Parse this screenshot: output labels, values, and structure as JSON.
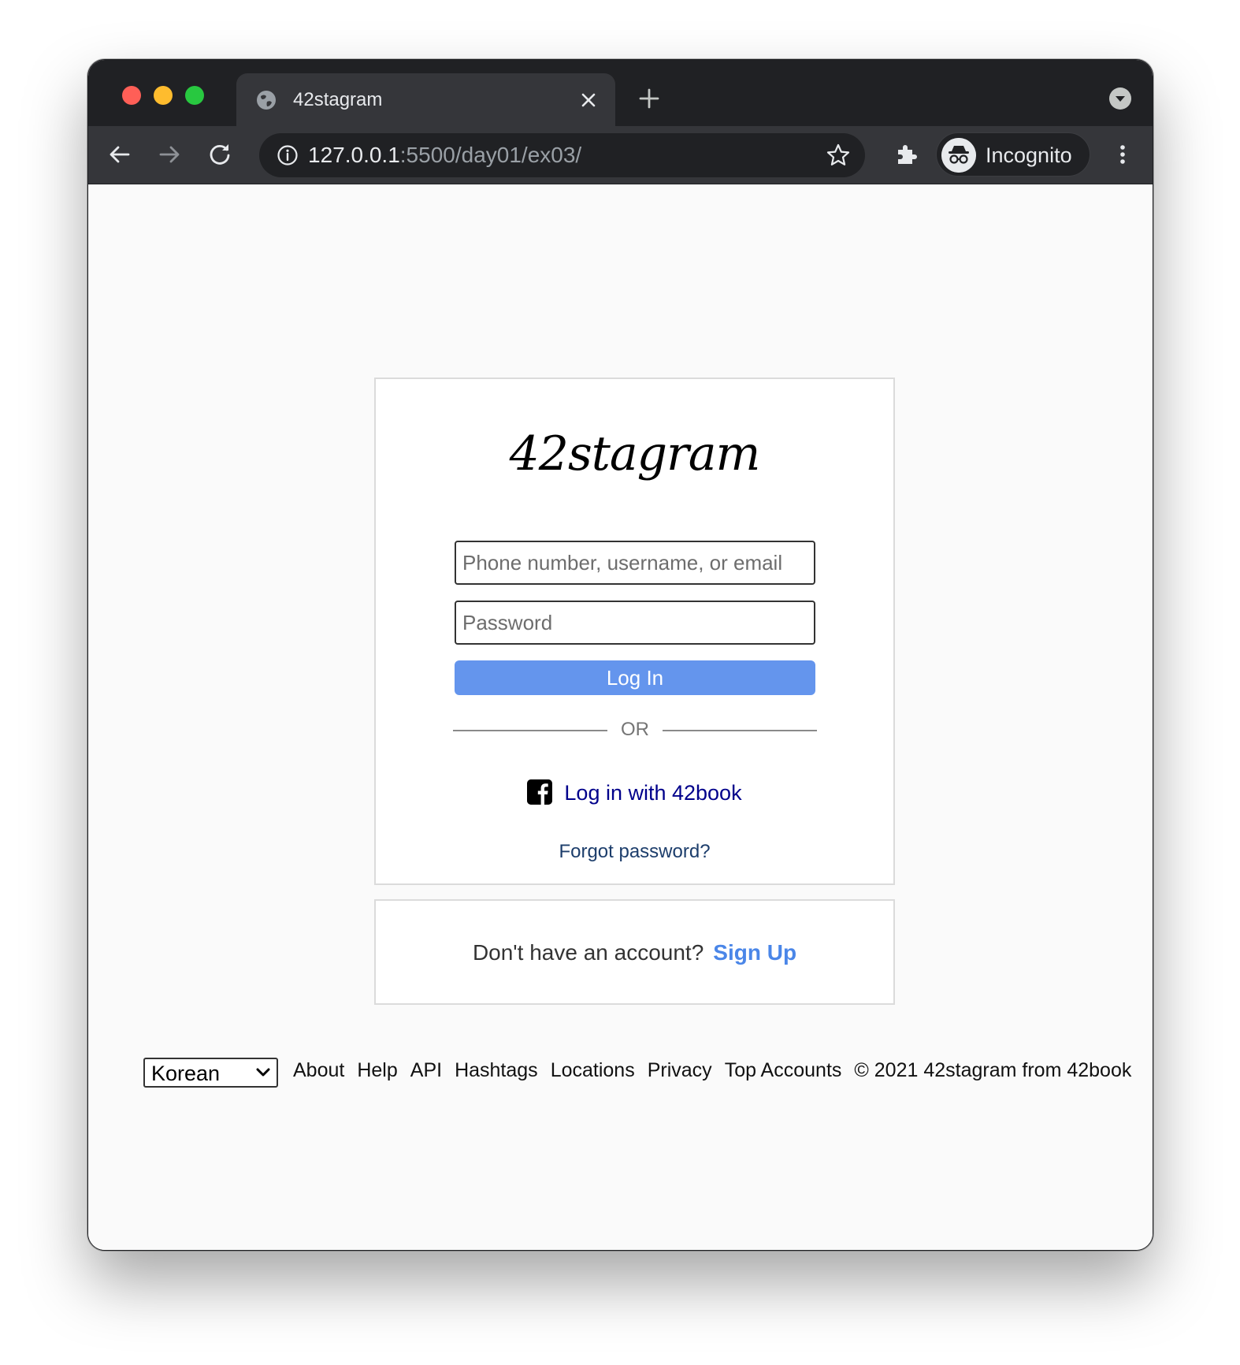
{
  "browser": {
    "tab_title": "42stagram",
    "url_host": "127.0.0.1",
    "url_rest": ":5500/day01/ex03/",
    "profile_label": "Incognito"
  },
  "icons": {
    "favicon": "globe-icon",
    "close": "close-icon",
    "new_tab": "plus-icon",
    "tab_search": "chevron-down-circle-icon",
    "back": "arrow-left-icon",
    "forward": "arrow-right-icon",
    "reload": "reload-icon",
    "site_info": "info-icon",
    "bookmark": "star-icon",
    "extensions": "puzzle-icon",
    "incognito": "incognito-icon",
    "menu": "kebab-icon",
    "facebook": "facebook-icon"
  },
  "login": {
    "logo": "42stagram",
    "username_placeholder": "Phone number, username, or email",
    "password_placeholder": "Password",
    "login_button": "Log In",
    "or_text": "OR",
    "social_login": "Log in with 42book",
    "forgot_password": "Forgot password?"
  },
  "signup": {
    "question": "Don't have an account?",
    "link": "Sign Up"
  },
  "footer": {
    "language": "Korean",
    "links": [
      "About",
      "Help",
      "API",
      "Hashtags",
      "Locations",
      "Privacy",
      "Top Accounts"
    ],
    "copyright": "© 2021 42stagram from 42book"
  },
  "colors": {
    "login_button": "#6495ed",
    "signup_link": "#4a86e8",
    "social_link": "#00008b",
    "browser_frame": "#202124",
    "toolbar": "#35363a"
  }
}
